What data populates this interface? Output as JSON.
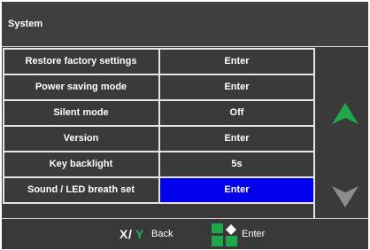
{
  "title": "System",
  "settings": [
    {
      "label": "Restore factory settings",
      "value": "Enter"
    },
    {
      "label": "Power saving mode",
      "value": "Enter"
    },
    {
      "label": "Silent mode",
      "value": "Off"
    },
    {
      "label": "Version",
      "value": "Enter"
    },
    {
      "label": "Key backlight",
      "value": "5s"
    },
    {
      "label": "Sound / LED breath set",
      "value": "Enter"
    }
  ],
  "footer": {
    "x_key": "X",
    "slash": "/",
    "y_key": "Y",
    "back_label": "Back",
    "enter_label": "Enter"
  },
  "icons": {
    "up": "up-arrow-icon",
    "down": "down-arrow-icon",
    "enter": "dpad-enter-icon"
  },
  "colors": {
    "selection": "#0000ee",
    "up_arrow": "#1fa84a",
    "y_key": "#22b14c"
  }
}
